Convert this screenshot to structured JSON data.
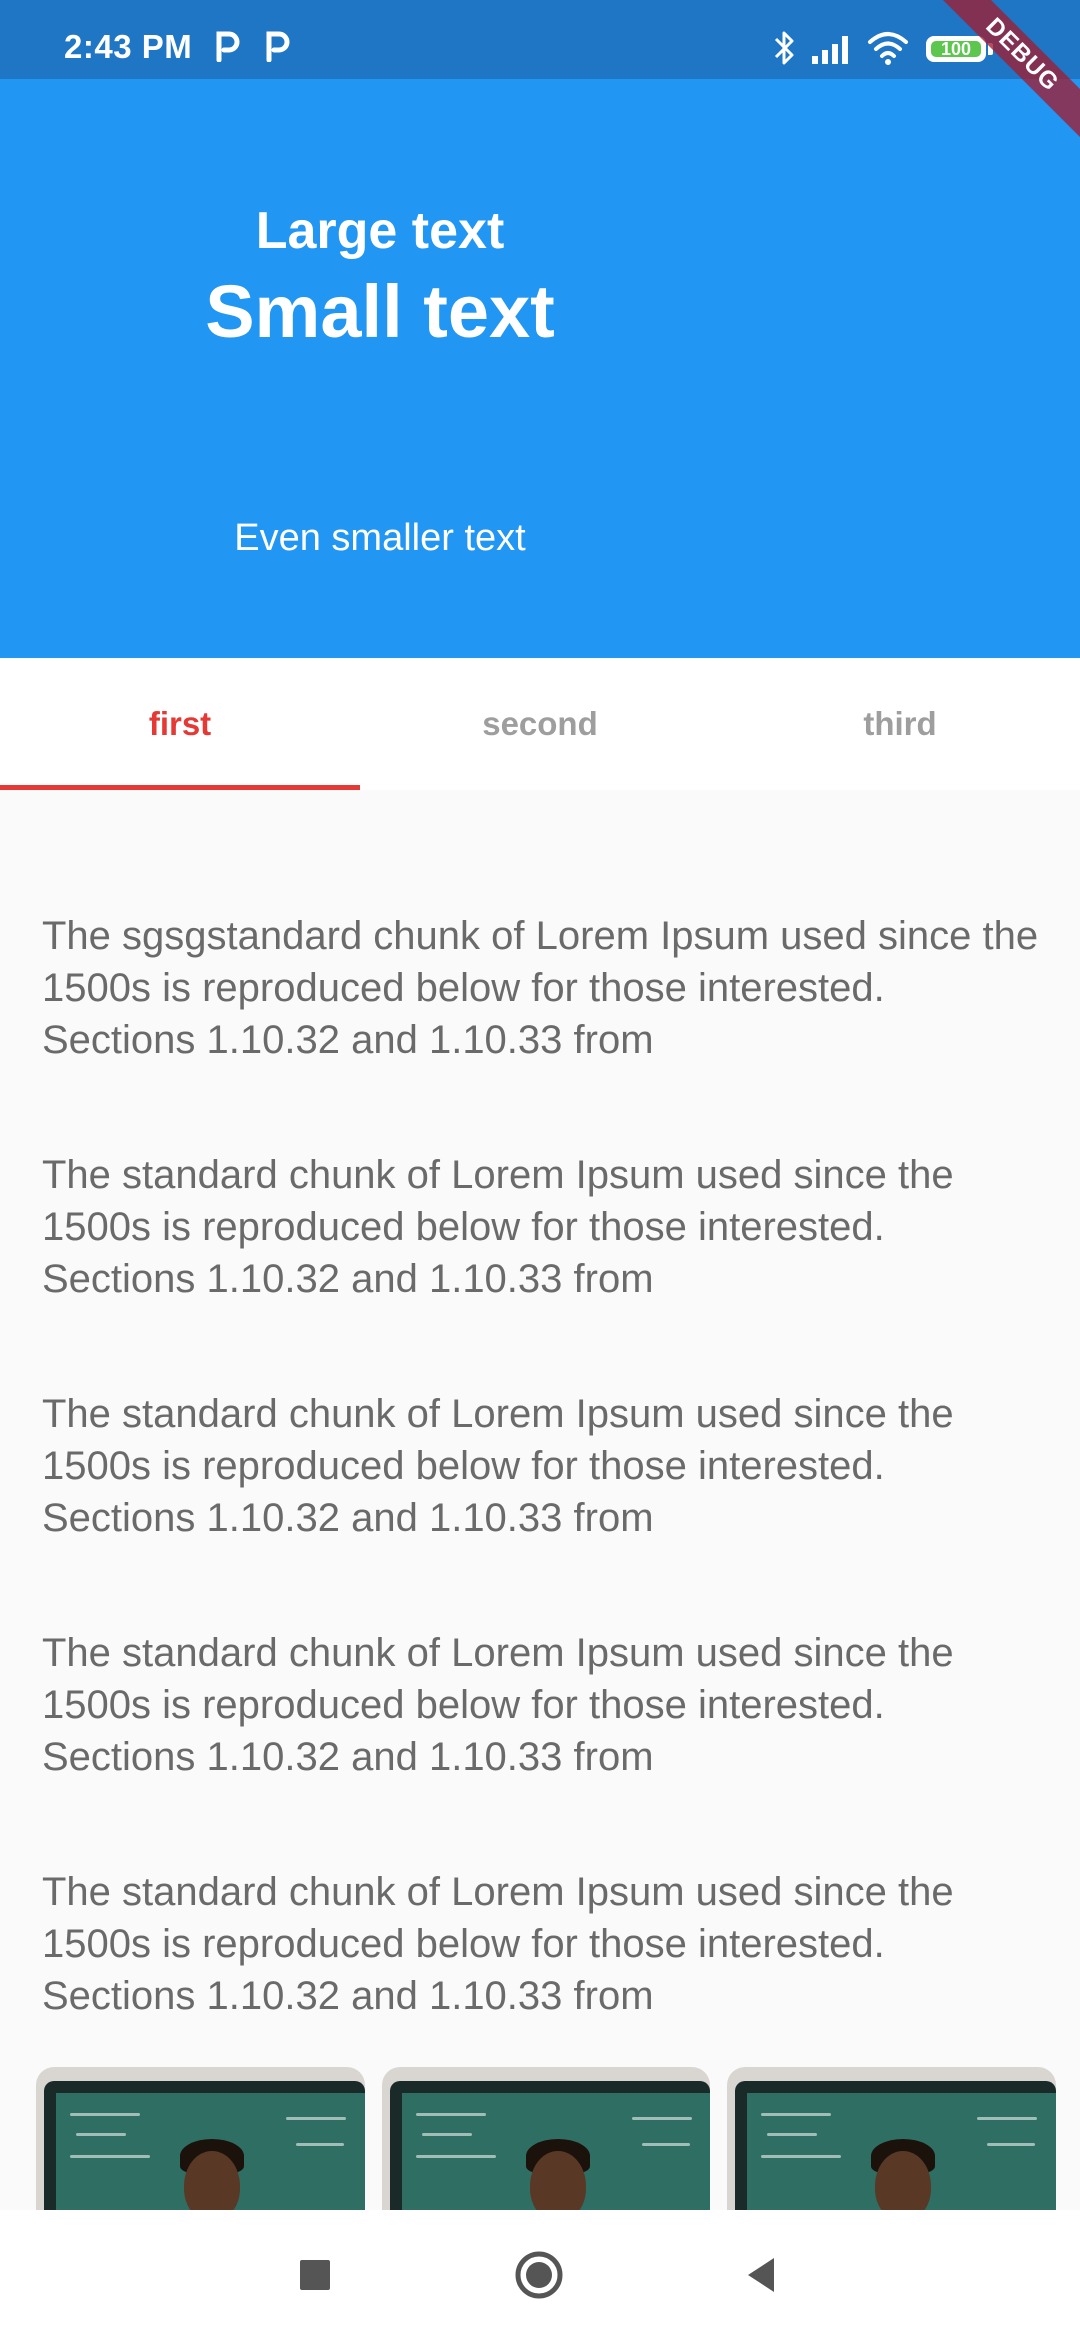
{
  "status_bar": {
    "time": "2:43 PM",
    "battery": "100",
    "icons": [
      "parking-icon",
      "parking-icon",
      "bluetooth-icon",
      "signal-icon",
      "wifi-icon",
      "battery-icon"
    ]
  },
  "debug_banner": "DEBUG",
  "header": {
    "large_text": "Large text",
    "small_text": "Small text",
    "smaller_text": "Even smaller text"
  },
  "tabs": [
    {
      "label": "first",
      "active": true
    },
    {
      "label": "second",
      "active": false
    },
    {
      "label": "third",
      "active": false
    }
  ],
  "paragraphs": [
    "The sgsgstandard chunk of Lorem Ipsum used since the 1500s is reproduced below for those interested. Sections 1.10.32 and 1.10.33 from",
    "The standard chunk of Lorem Ipsum used since the 1500s is reproduced below for those interested. Sections 1.10.32 and 1.10.33 from",
    "The standard chunk of Lorem Ipsum used since the 1500s is reproduced below for those interested. Sections 1.10.32 and 1.10.33 from",
    "The standard chunk of Lorem Ipsum used since the 1500s is reproduced below for those interested. Sections 1.10.32 and 1.10.33 from",
    "The standard chunk of Lorem Ipsum used since the 1500s is reproduced below for those interested. Sections 1.10.32 and 1.10.33 from"
  ],
  "thumbnails": [
    "teacher-chalkboard-image",
    "teacher-chalkboard-image",
    "teacher-chalkboard-image"
  ],
  "navbar": {
    "icons": [
      "recents-square-icon",
      "home-circle-icon",
      "back-triangle-icon"
    ]
  },
  "colors": {
    "status_bar": "#1f76c4",
    "header": "#2196f3",
    "tab_active": "#e53935",
    "tab_inactive": "#9e9e9e",
    "body_text": "#6a6a6a",
    "background": "#fafafa"
  }
}
